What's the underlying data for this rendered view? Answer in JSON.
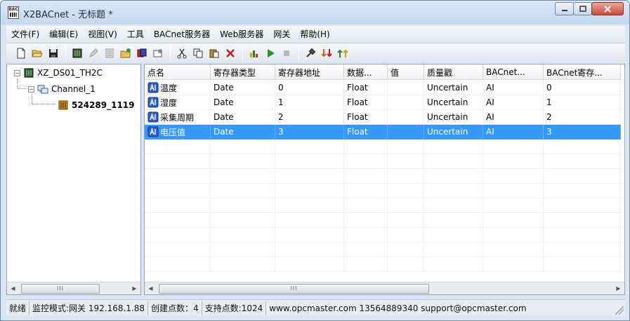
{
  "window": {
    "title": "X2BACnet - 无标题 *",
    "app_icon_text": "BAC"
  },
  "menu": [
    "文件(F)",
    "编辑(E)",
    "视图(V)",
    "工具",
    "BACnet服务器",
    "Web服务器",
    "网关",
    "帮助(H)"
  ],
  "tree": {
    "root": "XZ_DS01_TH2C",
    "channel": "Channel_1",
    "device": "524289_1119"
  },
  "table": {
    "columns": [
      "点名",
      "寄存器类型",
      "寄存器地址",
      "数据...",
      "值",
      "质量戳",
      "BACnet...",
      "BACnet寄存..."
    ],
    "rows": [
      [
        "温度",
        "Date",
        "0",
        "Float",
        "",
        "Uncertain",
        "AI",
        "0"
      ],
      [
        "湿度",
        "Date",
        "1",
        "Float",
        "",
        "Uncertain",
        "AI",
        "1"
      ],
      [
        "采集周期",
        "Date",
        "2",
        "Float",
        "",
        "Uncertain",
        "AI",
        "2"
      ],
      [
        "电压值",
        "Date",
        "3",
        "Float",
        "",
        "Uncertain",
        "AI",
        "3"
      ]
    ],
    "selected_row": 3
  },
  "status": {
    "state": "就绪",
    "mode": "监控模式:网关 192.168.1.88",
    "created": "创建点数：4",
    "supported": "支持点数:1024",
    "contact": "www.opcmaster.com 13564889340 support@opcmaster.com"
  },
  "colors": {
    "selection": "#3399ff",
    "frame": "#dbe6f3"
  }
}
